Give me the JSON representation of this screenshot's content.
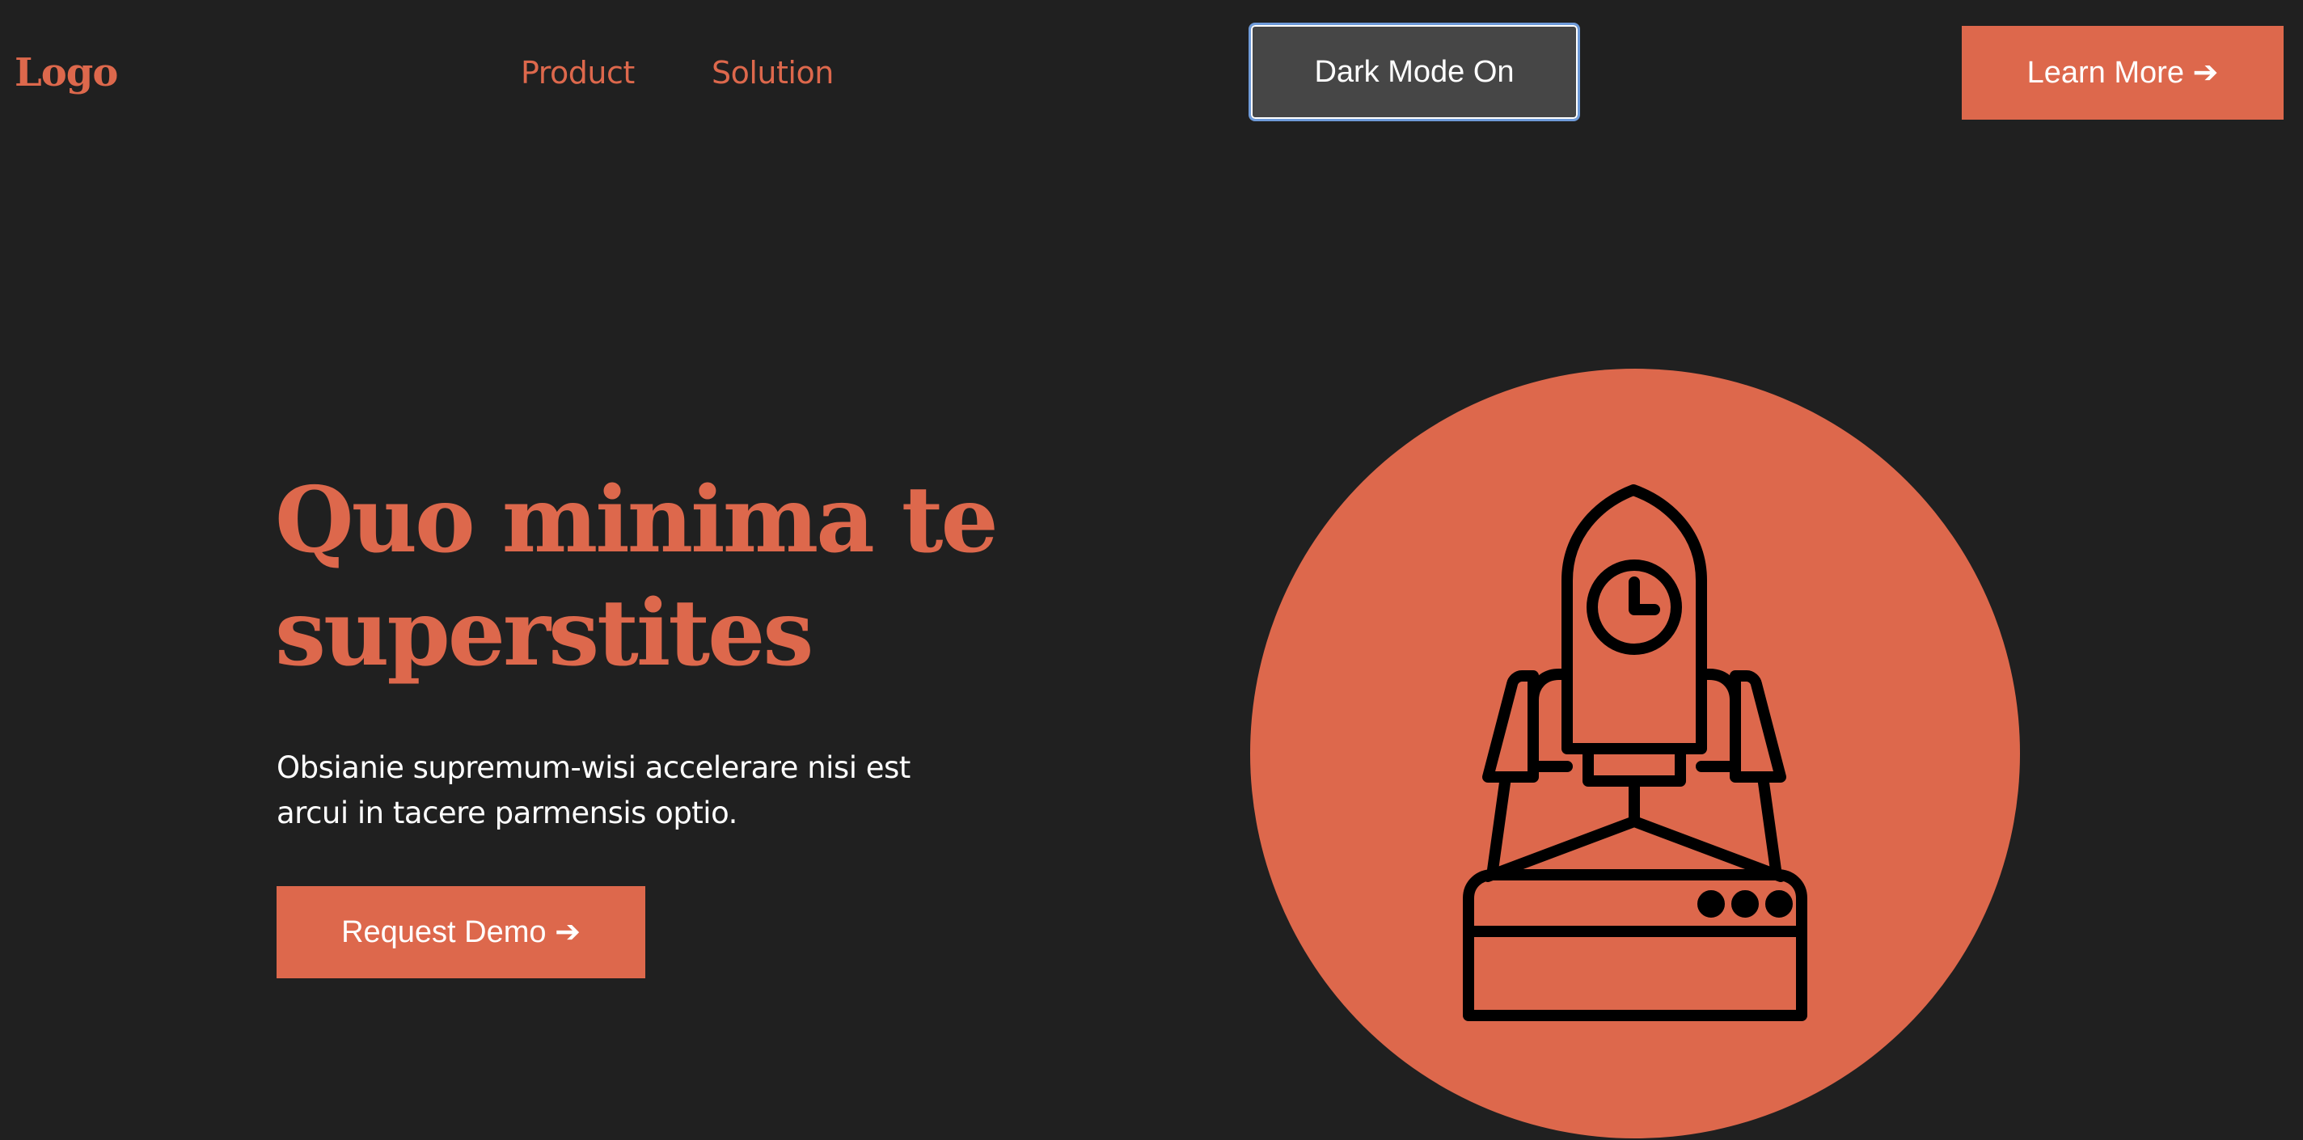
{
  "header": {
    "logo": "Logo",
    "nav": [
      {
        "label": "Product"
      },
      {
        "label": "Solution"
      }
    ],
    "dark_mode_toggle": "Dark Mode On",
    "learn_more": "Learn More ➔"
  },
  "hero": {
    "title_line1": "Quo minima te",
    "title_line2": "superstites",
    "text_line1": "Obsianie supremum-wisi accelerare nisi est",
    "text_line2": "arcui in tacere parmensis optio.",
    "cta": "Request Demo ➔",
    "illustration_icon": "rocket-launch-icon"
  },
  "colors": {
    "background": "#202020",
    "accent": "#dd684c",
    "toggle_bg": "#464646",
    "toggle_focus_ring": "#6e9ad8",
    "text": "#ffffff",
    "icon_stroke": "#000000"
  }
}
